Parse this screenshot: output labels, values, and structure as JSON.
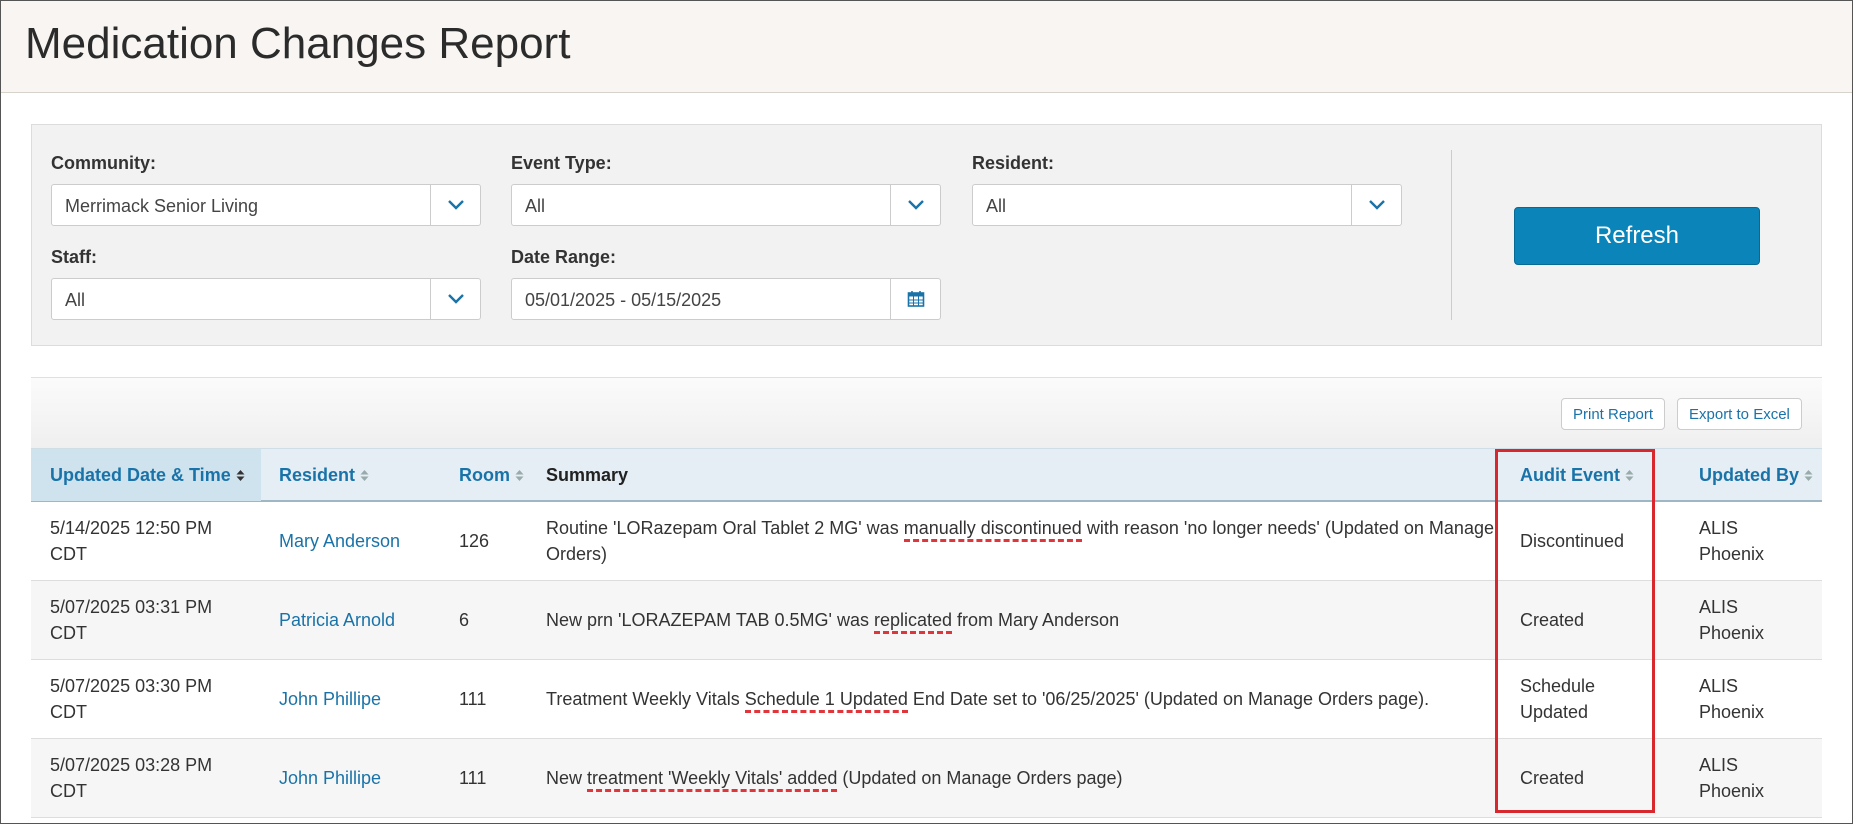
{
  "page": {
    "title": "Medication Changes Report"
  },
  "filters": {
    "community": {
      "label": "Community:",
      "value": "Merrimack Senior Living"
    },
    "event_type": {
      "label": "Event Type:",
      "value": "All"
    },
    "resident": {
      "label": "Resident:",
      "value": "All"
    },
    "staff": {
      "label": "Staff:",
      "value": "All"
    },
    "date_range": {
      "label": "Date Range:",
      "value": "05/01/2025 - 05/15/2025"
    },
    "refresh_label": "Refresh"
  },
  "toolbar": {
    "print_label": "Print Report",
    "export_label": "Export to Excel"
  },
  "table": {
    "headers": {
      "updated": "Updated Date & Time",
      "resident": "Resident",
      "room": "Room",
      "summary": "Summary",
      "audit": "Audit Event",
      "by": "Updated By"
    },
    "rows": [
      {
        "date1": "5/14/2025 12:50 PM",
        "date2": "CDT",
        "resident": "Mary Anderson",
        "room": "126",
        "sum_a": "Routine 'LORazepam Oral Tablet 2 MG' was ",
        "sum_u": "manually discontinued",
        "sum_b": " with reason 'no longer needs' (Updated on Manage",
        "sum_c": "Orders)",
        "audit1": "Discontinued",
        "audit2": "",
        "by1": "ALIS",
        "by2": "Phoenix"
      },
      {
        "date1": "5/07/2025 03:31 PM",
        "date2": "CDT",
        "resident": "Patricia Arnold",
        "room": "6",
        "sum_a": "New prn 'LORAZEPAM TAB 0.5MG' was ",
        "sum_u": "replicated",
        "sum_b": " from Mary Anderson",
        "sum_c": "",
        "audit1": "Created",
        "audit2": "",
        "by1": "ALIS",
        "by2": "Phoenix"
      },
      {
        "date1": "5/07/2025 03:30 PM",
        "date2": "CDT",
        "resident": "John Phillipe",
        "room": "111",
        "sum_a": "Treatment Weekly Vitals ",
        "sum_u": "Schedule 1 Updated",
        "sum_b": " End Date set to '06/25/2025' (Updated on Manage Orders page).",
        "sum_c": "",
        "audit1": "Schedule",
        "audit2": "Updated",
        "by1": "ALIS",
        "by2": "Phoenix"
      },
      {
        "date1": "5/07/2025 03:28 PM",
        "date2": "CDT",
        "resident": "John Phillipe",
        "room": "111",
        "sum_a": "New ",
        "sum_u": "treatment 'Weekly Vitals' added",
        "sum_b": " (Updated on Manage Orders page)",
        "sum_c": "",
        "audit1": "Created",
        "audit2": "",
        "by1": "ALIS",
        "by2": "Phoenix"
      }
    ]
  },
  "colors": {
    "accent": "#1a73a8",
    "button": "#0a84b9",
    "highlight": "#d8282e"
  },
  "icons": {
    "dropdown": "chevron-down-icon",
    "calendar": "calendar-icon",
    "sort": "sort-icon"
  }
}
